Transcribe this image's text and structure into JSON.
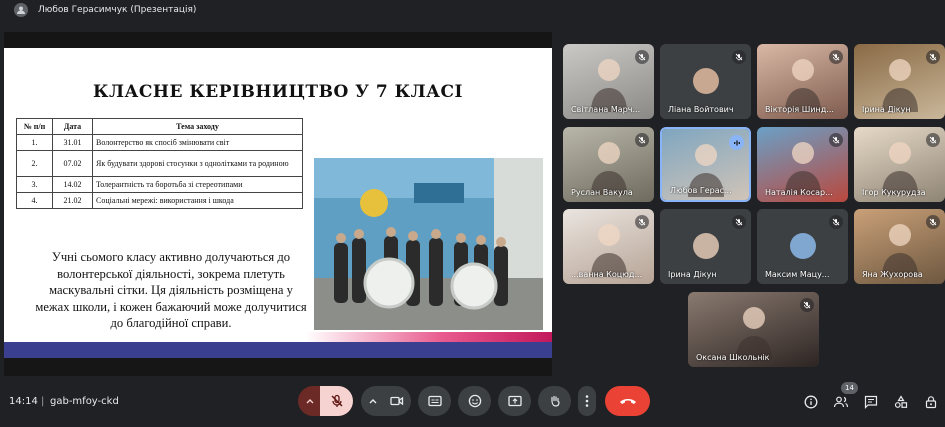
{
  "presenter": {
    "label": "Любов Герасимчук (Презентація)"
  },
  "slide": {
    "title": "КЛАСНЕ КЕРІВНИЦТВО У 7 КЛАСІ",
    "table": {
      "headers": [
        "№ п/п",
        "Дата",
        "Тема заходу"
      ],
      "rows": [
        [
          "1.",
          "31.01",
          "Волонтерство як спосіб змінювати світ"
        ],
        [
          "2.",
          "07.02",
          "Як будувати здорові стосунки з однолітками та родиною"
        ],
        [
          "3.",
          "14.02",
          "Толерантність та боротьба зі стереотипами"
        ],
        [
          "4.",
          "21.02",
          "Соціальні мережі: використання і шкода"
        ]
      ]
    },
    "body": "Учні сьомого класу активно долучаються до волонтерської діяльності, зокрема плетуть маскувальні сітки. Ця діяльність розміщена у межах школи, і кожен бажаючий може долучитися до благодійної справи."
  },
  "participants": [
    "Світлана Марч...",
    "Ліана Войтович",
    "Вікторія Шинд...",
    "Ірина Дікун",
    "Руслан Вакула",
    "Любов Герас...",
    "Наталія Косар...",
    "Ігор Кукурудза",
    "...ванна Коцюд...",
    "Ірина Дікун",
    "Максим Мацу...",
    "Яна Жухорова",
    "Оксана Школьнік"
  ],
  "meeting": {
    "time": "14:14",
    "separator": "|",
    "code": "gab-mfoy-ckd",
    "participant_count": "14"
  },
  "colors": {
    "background": "#202124",
    "end_call": "#ea4335",
    "mic_off": "#f6d2d0",
    "accent": "#8ab4f8"
  }
}
